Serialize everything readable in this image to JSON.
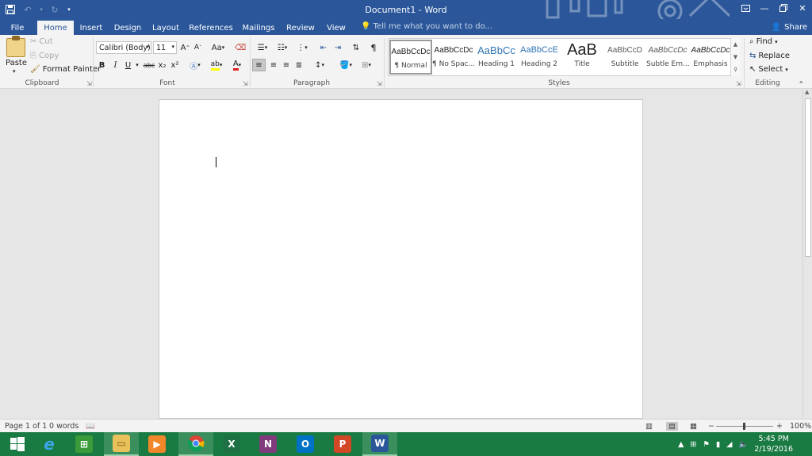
{
  "window": {
    "title": "Document1 - Word",
    "accent": "#2b579a"
  },
  "qat": {
    "save_icon": "save-icon",
    "undo_icon": "undo-icon",
    "redo_icon": "redo-icon",
    "customize_icon": "customize-qat-icon"
  },
  "tabs": [
    {
      "label": "File"
    },
    {
      "label": "Home"
    },
    {
      "label": "Insert"
    },
    {
      "label": "Design"
    },
    {
      "label": "Layout"
    },
    {
      "label": "References"
    },
    {
      "label": "Mailings"
    },
    {
      "label": "Review"
    },
    {
      "label": "View"
    }
  ],
  "active_tab": "Home",
  "tell_me": "Tell me what you want to do...",
  "share": "Share",
  "clipboard": {
    "paste": "Paste",
    "cut": "Cut",
    "copy": "Copy",
    "format_painter": "Format Painter",
    "label": "Clipboard"
  },
  "font": {
    "name": "Calibri (Body)",
    "size": "11",
    "change_case": "Aa",
    "label": "Font",
    "bold": "B",
    "italic": "I",
    "underline": "U",
    "strike": "abc",
    "subscript": "x₂",
    "superscript": "x²",
    "grow": "A",
    "shrink": "A",
    "font_color_glyph": "A"
  },
  "paragraph": {
    "label": "Paragraph",
    "pilcrow": "¶"
  },
  "styles": {
    "label": "Styles",
    "items": [
      {
        "sample": "AaBbCcDc",
        "name": "¶ Normal"
      },
      {
        "sample": "AaBbCcDc",
        "name": "¶ No Spac..."
      },
      {
        "sample": "AaBbCc",
        "name": "Heading 1"
      },
      {
        "sample": "AaBbCcE",
        "name": "Heading 2"
      },
      {
        "sample": "AaB",
        "name": "Title"
      },
      {
        "sample": "AaBbCcD",
        "name": "Subtitle"
      },
      {
        "sample": "AaBbCcDc",
        "name": "Subtle Em..."
      },
      {
        "sample": "AaBbCcDc",
        "name": "Emphasis"
      }
    ]
  },
  "editing": {
    "label": "Editing",
    "find": "Find",
    "replace": "Replace",
    "select": "Select"
  },
  "status": {
    "page": "Page 1 of 1",
    "words": "0 words",
    "zoom": "100%",
    "zoom_minus": "−",
    "zoom_plus": "+"
  },
  "taskbar": {
    "apps": [
      "start",
      "internet-explorer",
      "store",
      "file-explorer",
      "media-player",
      "chrome",
      "excel",
      "onenote",
      "outlook",
      "powerpoint",
      "word"
    ],
    "time": "5:45 PM",
    "date": "2/19/2016"
  }
}
